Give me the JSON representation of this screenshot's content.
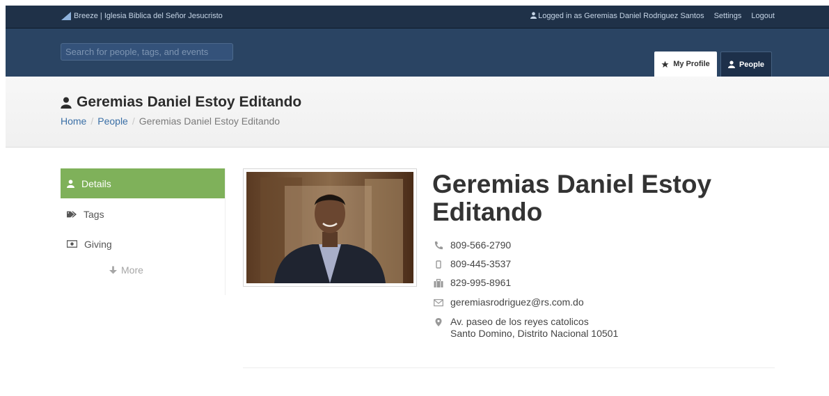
{
  "topbar": {
    "brand": "Breeze | Iglesia Biblica del Señor Jesucristo",
    "logged_in": "Logged in as Geremias Daniel Rodriguez Santos",
    "settings": "Settings",
    "logout": "Logout"
  },
  "navbar": {
    "search_placeholder": "Search for people, tags, and events",
    "tabs": [
      {
        "label": "My Profile",
        "icon": "star-icon",
        "active": true
      },
      {
        "label": "People",
        "icon": "user-icon",
        "active": false
      }
    ]
  },
  "header": {
    "title": "Geremias Daniel Estoy Editando",
    "breadcrumb": [
      "Home",
      "People",
      "Geremias Daniel Estoy Editando"
    ],
    "separator": "/"
  },
  "sidebar": {
    "items": [
      {
        "label": "Details",
        "icon": "user-icon",
        "active": true
      },
      {
        "label": "Tags",
        "icon": "tags-icon",
        "active": false
      },
      {
        "label": "Giving",
        "icon": "money-icon",
        "active": false
      }
    ],
    "more": "More"
  },
  "profile": {
    "name": "Geremias Daniel Estoy Editando",
    "phones": [
      {
        "icon": "phone-icon",
        "value": "809-566-2790"
      },
      {
        "icon": "mobile-icon",
        "value": "809-445-3537"
      },
      {
        "icon": "briefcase-icon",
        "value": "829-995-8961"
      }
    ],
    "email": "geremiasrodriguez@rs.com.do",
    "address": {
      "line1": "Av. paseo de los reyes catolicos",
      "line2": "Santo Domino, Distrito Nacional 10501"
    }
  },
  "colors": {
    "topbar": "#1f3148",
    "navbar": "#2a4463",
    "active_side": "#7fb15a",
    "link": "#3a6fa6"
  }
}
